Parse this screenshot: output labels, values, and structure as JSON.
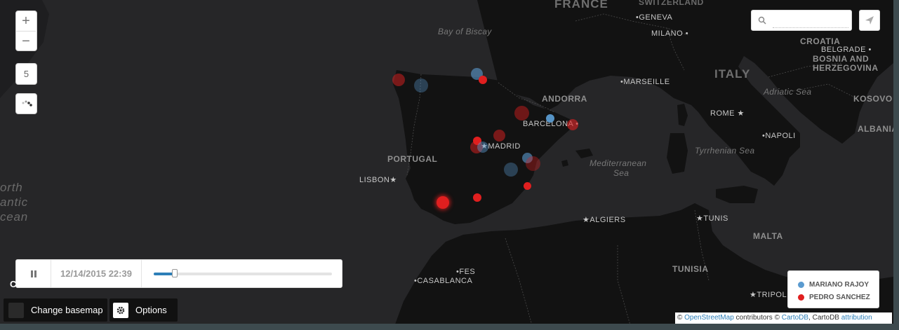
{
  "map": {
    "ocean_labels": [
      {
        "id": "atlantic-1",
        "text": "orth"
      },
      {
        "id": "atlantic-2",
        "text": "antic"
      },
      {
        "id": "atlantic-3",
        "text": "cean"
      }
    ],
    "countries": [
      {
        "id": "france",
        "text": "FRANCE"
      },
      {
        "id": "switzerland",
        "text": "SWITZERLAND"
      },
      {
        "id": "italy",
        "text": "ITALY"
      },
      {
        "id": "andorra",
        "text": "ANDORRA"
      },
      {
        "id": "portugal",
        "text": "PORTUGAL"
      },
      {
        "id": "croatia",
        "text": "CROATIA"
      },
      {
        "id": "bosnia-1",
        "text": "BOSNIA AND"
      },
      {
        "id": "bosnia-2",
        "text": "HERZEGOVINA"
      },
      {
        "id": "kosovo",
        "text": "KOSOVO"
      },
      {
        "id": "albania",
        "text": "ALBANIA"
      },
      {
        "id": "tunisia",
        "text": "TUNISIA"
      },
      {
        "id": "malta",
        "text": "MALTA"
      }
    ],
    "seas": [
      {
        "id": "bay-of-biscay",
        "text": "Bay of Biscay"
      },
      {
        "id": "adriatic",
        "text": "Adriatic Sea"
      },
      {
        "id": "tyrrhenian",
        "text": "Tyrrhenian Sea"
      },
      {
        "id": "mediterranean-1",
        "text": "Mediterranean"
      },
      {
        "id": "mediterranean-2",
        "text": "Sea"
      }
    ],
    "cities": [
      {
        "id": "geneva",
        "text": "GENEVA"
      },
      {
        "id": "milano",
        "text": "MILANO"
      },
      {
        "id": "belgrade",
        "text": "BELGRADE"
      },
      {
        "id": "marseille",
        "text": "MARSEILLE"
      },
      {
        "id": "rome",
        "text": "ROME"
      },
      {
        "id": "barcelona",
        "text": "BARCELONA"
      },
      {
        "id": "madrid",
        "text": "MADRID"
      },
      {
        "id": "napoli",
        "text": "NAPOLI"
      },
      {
        "id": "lisbon",
        "text": "LISBON"
      },
      {
        "id": "algiers",
        "text": "ALGIERS"
      },
      {
        "id": "tunis",
        "text": "TUNIS"
      },
      {
        "id": "fes",
        "text": "FES"
      },
      {
        "id": "casablanca",
        "text": "CASABLANCA"
      },
      {
        "id": "tripoli",
        "text": "TRIPOLI"
      }
    ]
  },
  "controls": {
    "zoom_in": "+",
    "zoom_out": "−",
    "zoom_level": "5",
    "search_placeholder": "",
    "search_value": ""
  },
  "timeline": {
    "date": "12/14/2015 22:39",
    "progress": 0.12
  },
  "legend": {
    "items": [
      {
        "label": "MARIANO RAJOY",
        "color": "#5b9bd0"
      },
      {
        "label": "PEDRO SANCHEZ",
        "color": "#e01f1f"
      }
    ]
  },
  "buttons": {
    "basemap": "Change basemap",
    "options": "Options"
  },
  "logo": {
    "text": "CARTODB"
  },
  "attribution": {
    "prefix": "© ",
    "osm": "OpenStreetMap",
    "middle": " contributors © ",
    "cartodb": "CartoDB",
    "middle2": ", CartoDB ",
    "attr": "attribution"
  },
  "colors": {
    "rajoy": "#5b9bd0",
    "sanchez": "#e01f1f",
    "land": "#121212",
    "water": "#262628"
  }
}
